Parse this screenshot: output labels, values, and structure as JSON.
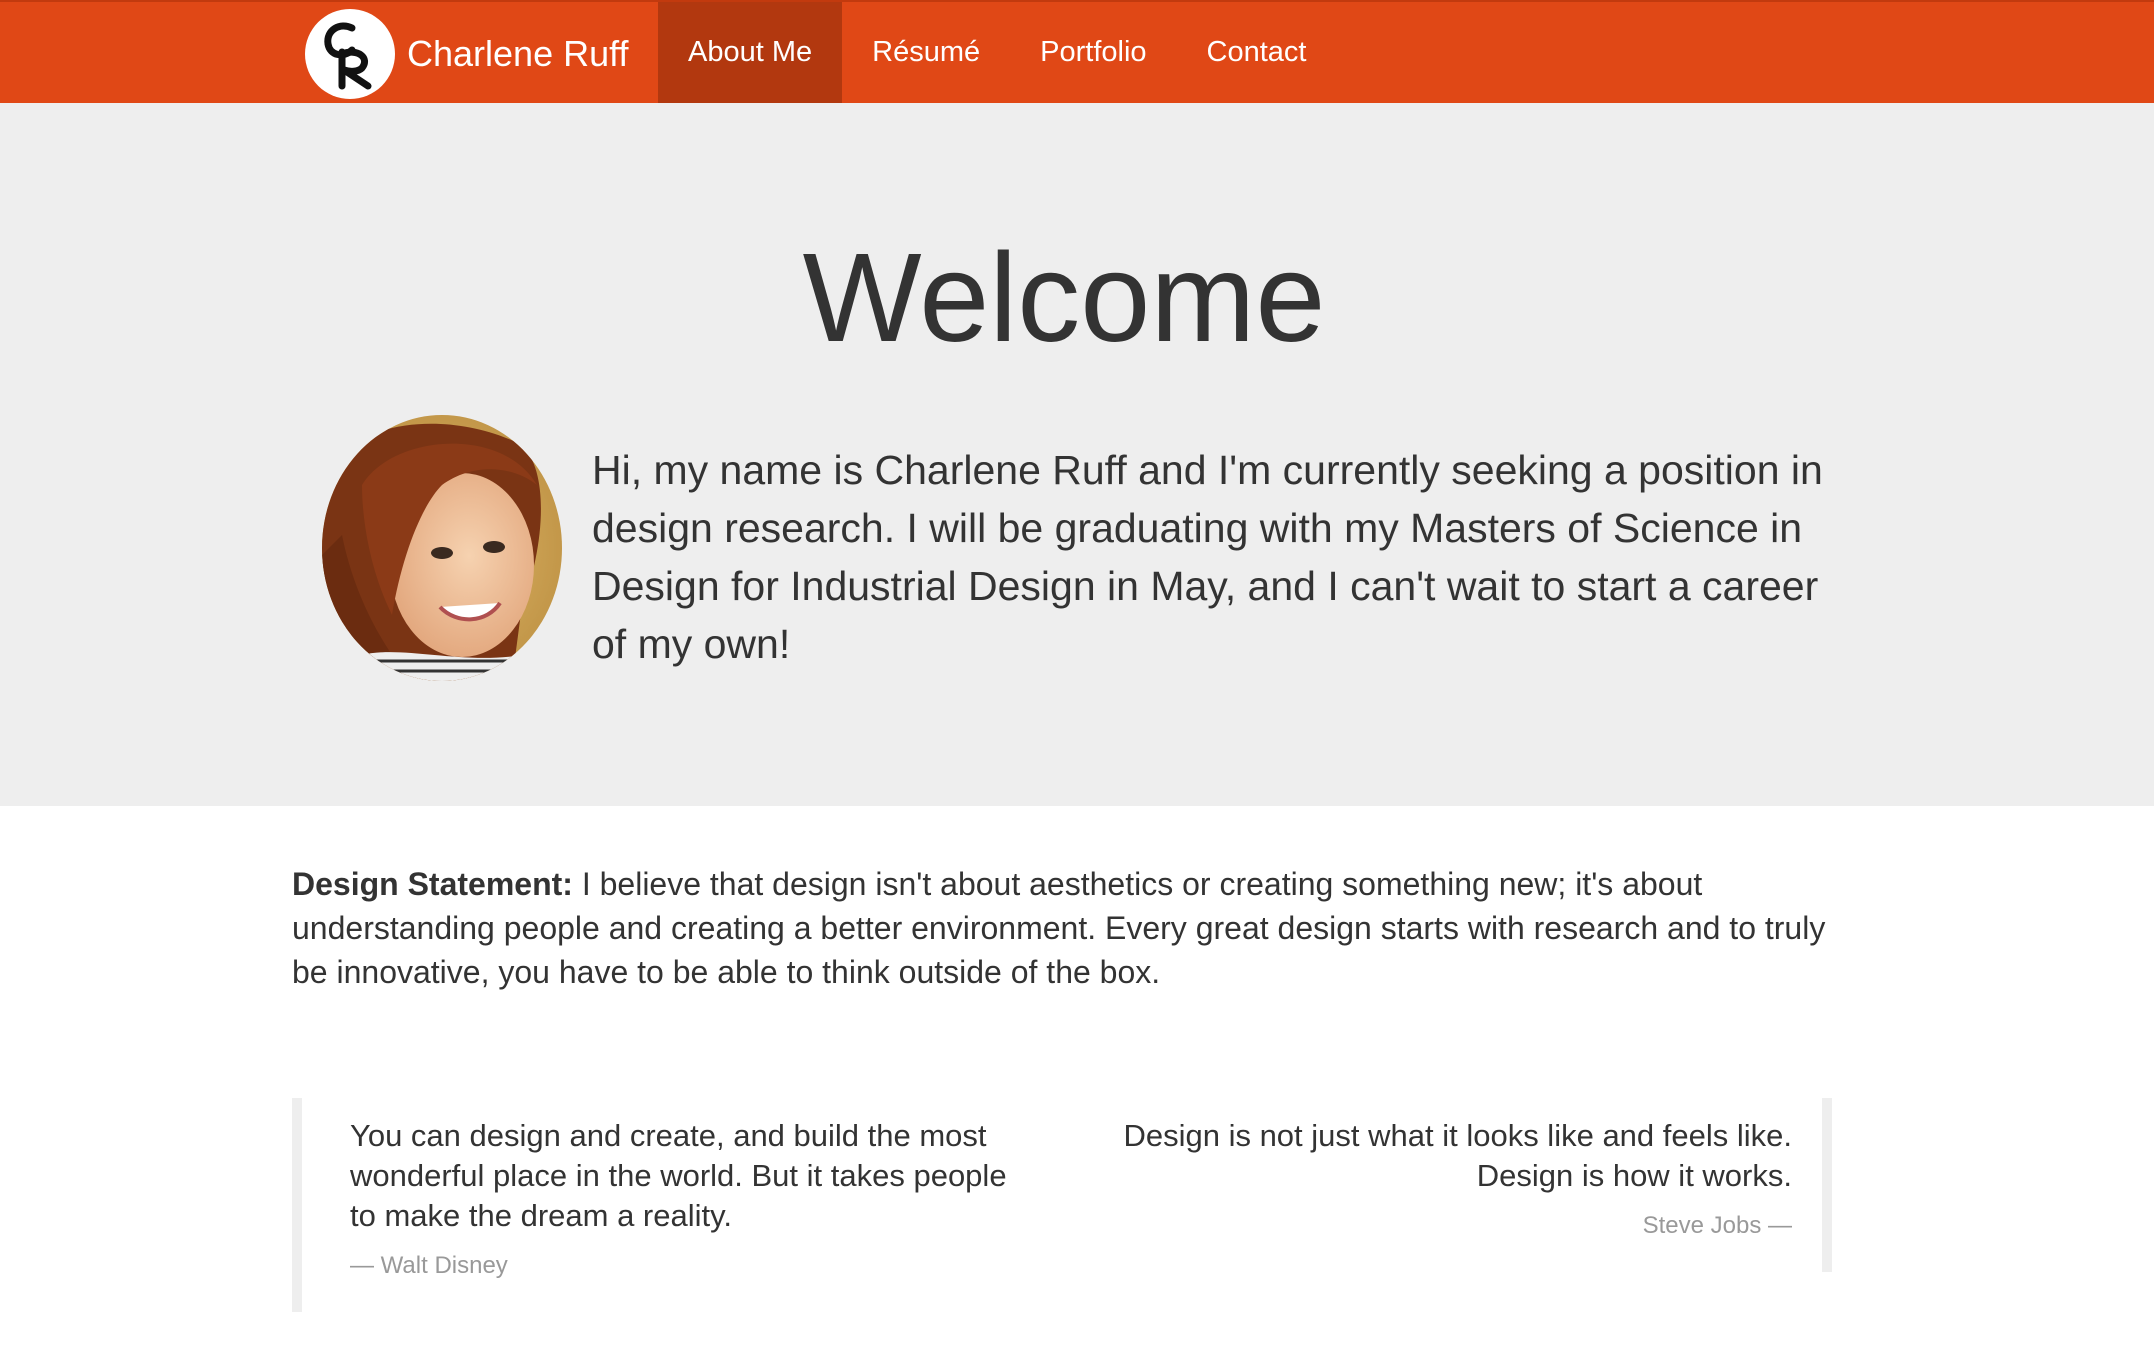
{
  "navbar": {
    "brand_name": "Charlene Ruff",
    "logo_icon": "cr-monogram-logo",
    "items": [
      {
        "label": "About Me",
        "active": true
      },
      {
        "label": "Résumé",
        "active": false
      },
      {
        "label": "Portfolio",
        "active": false
      },
      {
        "label": "Contact",
        "active": false
      }
    ]
  },
  "hero": {
    "title": "Welcome",
    "intro": "Hi, my name is Charlene Ruff and I'm currently seeking a position in design research. I will be graduating with my Masters of Science in Design for Industrial Design in May, and I can't wait to start a career of my own!"
  },
  "statement": {
    "label": "Design Statement:",
    "text": " I believe that design isn't about aesthetics or creating something new; it's about understanding people and creating a better environment. Every great design starts with research and to truly be innovative, you have to be able to think outside of the box."
  },
  "quotes": [
    {
      "text": "You can design and create, and build the most wonderful place in the world. But it takes people to make the dream a reality.",
      "cite": "— Walt Disney"
    },
    {
      "text": "Design is not just what it looks like and feels like. Design is how it works.",
      "cite": "Steve Jobs —"
    }
  ],
  "colors": {
    "navbar": "#e04816",
    "navbar_active": "#b2380f",
    "hero_bg": "#eeeeee",
    "text": "#333333",
    "muted": "#999999"
  }
}
